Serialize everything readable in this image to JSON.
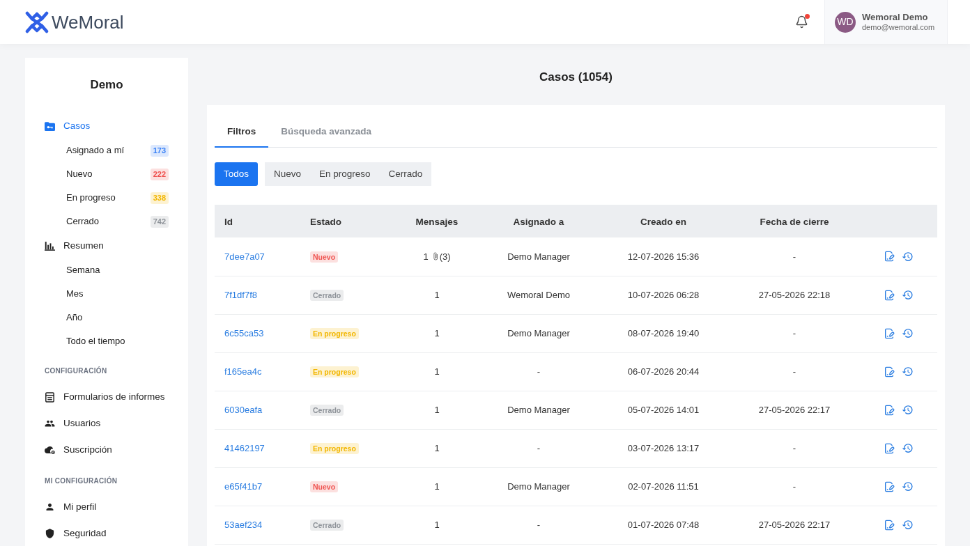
{
  "header": {
    "logo": {
      "text": "WeMoral"
    },
    "notifications": {
      "unread": true
    },
    "user": {
      "initials": "WD",
      "name": "Wemoral Demo",
      "email": "demo@wemoral.com"
    }
  },
  "sidebar": {
    "title": "Demo",
    "sections": [
      {
        "items": [
          {
            "label": "Casos",
            "selected": true,
            "children": [
              {
                "label": "Asignado a mí",
                "count": "173",
                "color": "#3b82f6",
                "selected": false
              },
              {
                "label": "Nuevo",
                "count": "222",
                "color": "#ef5350",
                "selected": false
              },
              {
                "label": "En progreso",
                "count": "338",
                "color": "#f2b600",
                "selected": false
              },
              {
                "label": "Cerrado",
                "count": "742",
                "color": "#8e9399",
                "selected": false
              }
            ]
          },
          {
            "label": "Resumen",
            "selected": false,
            "children": [
              {
                "label": "Semana",
                "selected": false
              },
              {
                "label": "Mes",
                "selected": false
              },
              {
                "label": "Año",
                "selected": false
              },
              {
                "label": "Todo el tiempo",
                "selected": false
              }
            ]
          }
        ]
      },
      {
        "heading": "CONFIGURACIÓN",
        "items": [
          {
            "label": "Formularios de informes",
            "selected": false
          },
          {
            "label": "Usuarios",
            "selected": false
          },
          {
            "label": "Suscripción",
            "selected": false
          }
        ]
      },
      {
        "heading": "MI CONFIGURACIÓN",
        "items": [
          {
            "label": "Mi perfil",
            "selected": false
          },
          {
            "label": "Seguridad",
            "selected": false
          }
        ]
      }
    ]
  },
  "main": {
    "title": "Casos (1054)",
    "tabs": [
      {
        "label": "Filtros",
        "selected": true
      },
      {
        "label": "Búsqueda avanzada",
        "selected": false
      }
    ],
    "filters": [
      {
        "label": "Todos",
        "selected": true
      },
      {
        "label": "Nuevo",
        "selected": false
      },
      {
        "label": "En progreso",
        "selected": false
      },
      {
        "label": "Cerrado",
        "selected": false
      }
    ],
    "table": {
      "columns": [
        "Id",
        "Estado",
        "Mensajes",
        "Asignado a",
        "Creado en",
        "Fecha de cierre"
      ],
      "rows": [
        {
          "id": "7dee7a07",
          "status": {
            "label": "Nuevo",
            "color": "#ef5350"
          },
          "messages": "1",
          "attachments": "(3)",
          "assigned_to": "Demo Manager",
          "created": "12-07-2026 15:36",
          "closed": "-"
        },
        {
          "id": "7f1df7f8",
          "status": {
            "label": "Cerrado",
            "color": "#8e9399"
          },
          "messages": "1",
          "assigned_to": "Wemoral Demo",
          "created": "10-07-2026 06:28",
          "closed": "27-05-2026 22:18"
        },
        {
          "id": "6c55ca53",
          "status": {
            "label": "En progreso",
            "color": "#f2b600"
          },
          "messages": "1",
          "assigned_to": "Demo Manager",
          "created": "08-07-2026 19:40",
          "closed": "-"
        },
        {
          "id": "f165ea4c",
          "status": {
            "label": "En progreso",
            "color": "#f2b600"
          },
          "messages": "1",
          "assigned_to": "-",
          "created": "06-07-2026 20:44",
          "closed": "-"
        },
        {
          "id": "6030eafa",
          "status": {
            "label": "Cerrado",
            "color": "#8e9399"
          },
          "messages": "1",
          "assigned_to": "Demo Manager",
          "created": "05-07-2026 14:01",
          "closed": "27-05-2026 22:17"
        },
        {
          "id": "41462197",
          "status": {
            "label": "En progreso",
            "color": "#f2b600"
          },
          "messages": "1",
          "assigned_to": "-",
          "created": "03-07-2026 13:17",
          "closed": "-"
        },
        {
          "id": "e65f41b7",
          "status": {
            "label": "Nuevo",
            "color": "#ef5350"
          },
          "messages": "1",
          "assigned_to": "Demo Manager",
          "created": "02-07-2026 11:51",
          "closed": "-"
        },
        {
          "id": "53aef234",
          "status": {
            "label": "Cerrado",
            "color": "#8e9399"
          },
          "messages": "1",
          "assigned_to": "-",
          "created": "01-07-2026 07:48",
          "closed": "27-05-2026 22:17"
        }
      ]
    }
  }
}
